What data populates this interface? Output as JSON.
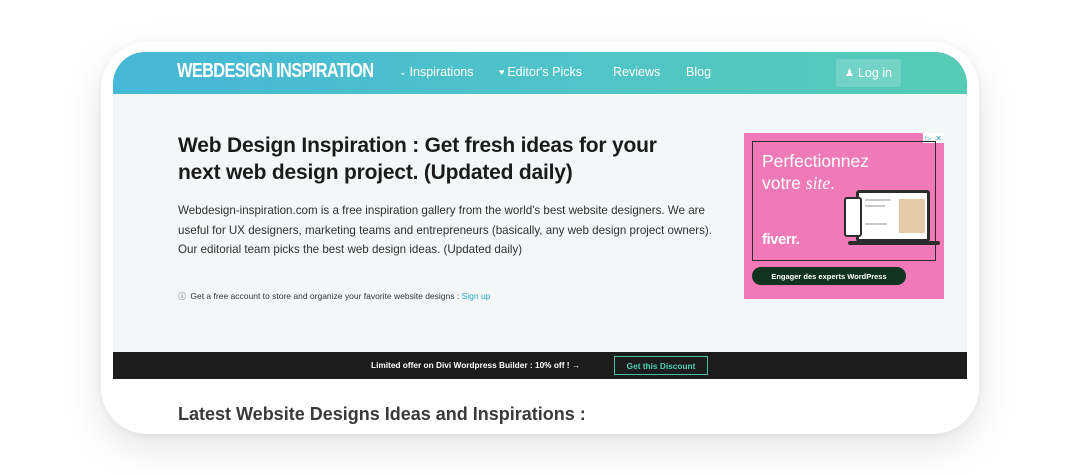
{
  "header": {
    "logo": "WEBDESIGN INSPIRATION",
    "nav": [
      {
        "icon": "chevron-down-icon",
        "glyph": "⌄",
        "label": "Inspirations"
      },
      {
        "icon": "heart-icon",
        "glyph": "♥",
        "label": "Editor's Picks"
      },
      {
        "label": "Reviews"
      },
      {
        "label": "Blog"
      }
    ],
    "login": {
      "icon": "user-icon",
      "glyph": "👤",
      "label": "Log in"
    }
  },
  "hero": {
    "title": "Web Design Inspiration : Get fresh ideas for your next web design project. (Updated daily)",
    "description": "Webdesign-inspiration.com is a free inspiration gallery from the world's best website designers. We are useful for UX designers, marketing teams and entrepreneurs (basically, any web design project owners). Our editorial team picks the best web design ideas. (Updated daily)",
    "note": "Get a free account to store and organize your favorite website designs :",
    "signup": "Sign up"
  },
  "ad": {
    "headline_line1": "Perfectionnez",
    "headline_line2": "votre",
    "headline_em": "site",
    "brand": "fiverr.",
    "cta": "Engager des experts WordPress",
    "bg_color": "#f07ab8"
  },
  "promo": {
    "text": "Limited offer on Divi Wordpress Builder : 10% off ! →",
    "button": "Get this Discount"
  },
  "section": {
    "title": "Latest Website Designs Ideas and Inspirations :"
  },
  "colors": {
    "header_gradient_start": "#46b7d6",
    "header_gradient_end": "#56ccb6",
    "link": "#2aa7c9",
    "accent": "#4fd1b1"
  }
}
